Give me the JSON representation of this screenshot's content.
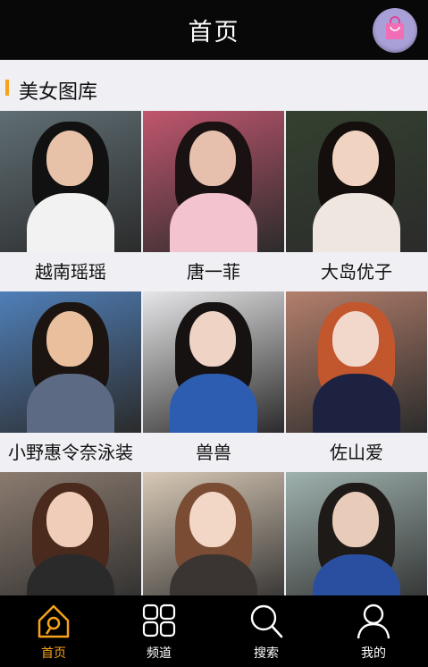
{
  "header": {
    "title": "首页",
    "cart_icon": "shopping-bag-icon"
  },
  "section": {
    "title": "美女图库",
    "accent_color": "#f7a21b"
  },
  "gallery": [
    {
      "caption": "越南瑶瑶",
      "bg": "#5f6e74",
      "hair": "#111111",
      "skin": "#e8c2a8",
      "body": "#f2f2f2"
    },
    {
      "caption": "唐一菲",
      "bg": "#c0566e",
      "hair": "#1a1212",
      "skin": "#e7c0ad",
      "body": "#f4c3d0"
    },
    {
      "caption": "大岛优子",
      "bg": "#34412f",
      "hair": "#140f0c",
      "skin": "#f0d3c0",
      "body": "#f0e6e0"
    },
    {
      "caption": "小野惠令奈泳装",
      "bg": "#4f7fb8",
      "hair": "#1b1410",
      "skin": "#e9bf9e",
      "body": "#5c6a84"
    },
    {
      "caption": "兽兽",
      "bg": "#e6e6e8",
      "hair": "#161212",
      "skin": "#efd3c4",
      "body": "#2d5db0"
    },
    {
      "caption": "佐山爱",
      "bg": "#b37f6c",
      "hair": "#c2572e",
      "skin": "#f1d8cb",
      "body": "#1c2240"
    },
    {
      "caption": "",
      "bg": "#8b7b6f",
      "hair": "#4a2a1c",
      "skin": "#efcdb8",
      "body": "#2a2a2a"
    },
    {
      "caption": "",
      "bg": "#d8c9b6",
      "hair": "#7a4c34",
      "skin": "#f3d7c6",
      "body": "#3a3432"
    },
    {
      "caption": "",
      "bg": "#9fb2ae",
      "hair": "#1e1a18",
      "skin": "#e8ccb9",
      "body": "#2b4fa0"
    }
  ],
  "tabs": [
    {
      "label": "首页",
      "icon": "home-icon",
      "active": true
    },
    {
      "label": "频道",
      "icon": "grid-icon",
      "active": false
    },
    {
      "label": "搜索",
      "icon": "search-icon",
      "active": false
    },
    {
      "label": "我的",
      "icon": "user-icon",
      "active": false
    }
  ]
}
